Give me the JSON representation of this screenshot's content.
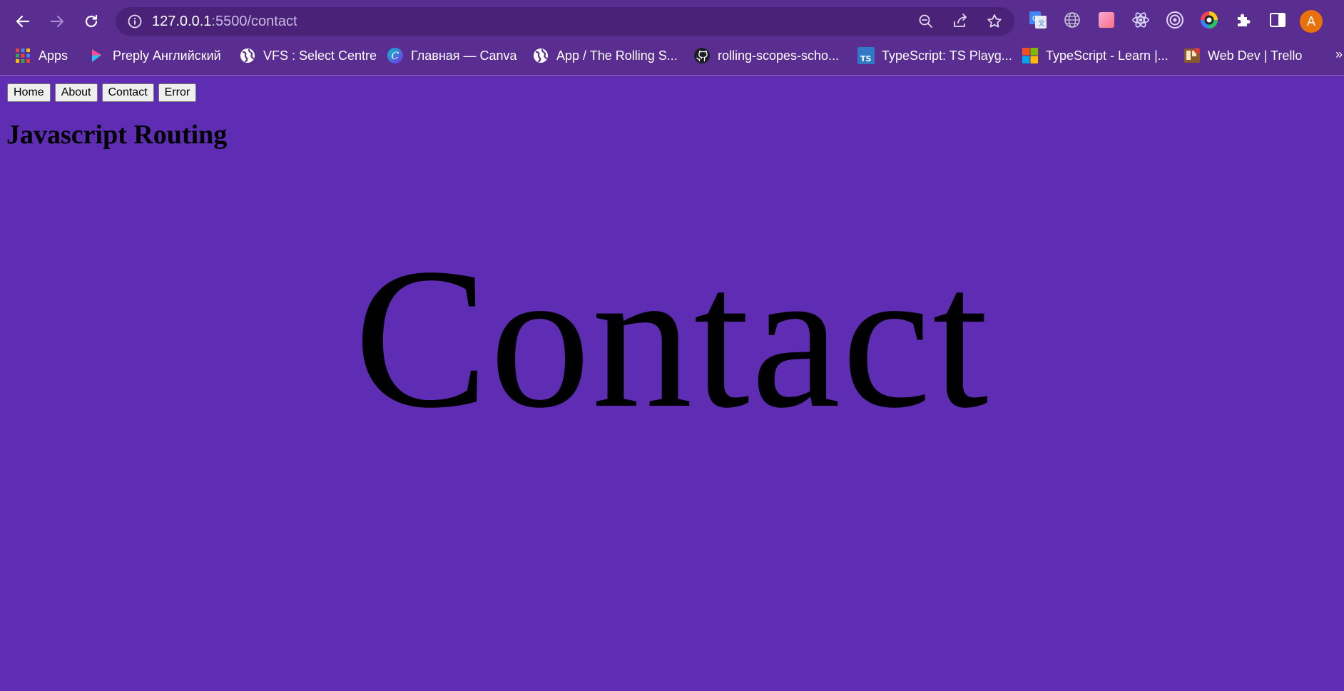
{
  "browser": {
    "url_host": "127.0.0.1",
    "url_rest": ":5500/contact",
    "profile_initial": "A",
    "bookmarks": [
      {
        "label": "Apps",
        "icon": "apps-grid-icon"
      },
      {
        "label": "Preply Английский",
        "icon": "preply-icon"
      },
      {
        "label": "VFS : Select Centre",
        "icon": "globe-icon"
      },
      {
        "label": "Главная — Canva",
        "icon": "canva-icon"
      },
      {
        "label": "App / The Rolling S...",
        "icon": "globe-icon"
      },
      {
        "label": "rolling-scopes-scho...",
        "icon": "github-icon"
      },
      {
        "label": "TypeScript: TS Playg...",
        "icon": "typescript-icon"
      },
      {
        "label": "TypeScript - Learn |...",
        "icon": "microsoft-icon"
      },
      {
        "label": "Web Dev | Trello",
        "icon": "trello-icon"
      }
    ]
  },
  "page": {
    "nav_buttons": [
      "Home",
      "About",
      "Contact",
      "Error"
    ],
    "title": "Javascript Routing",
    "hero": "Contact"
  },
  "colors": {
    "page_background": "#5e2db3",
    "chrome_background": "#5a2d91",
    "omnibox_background": "#4a2378"
  }
}
